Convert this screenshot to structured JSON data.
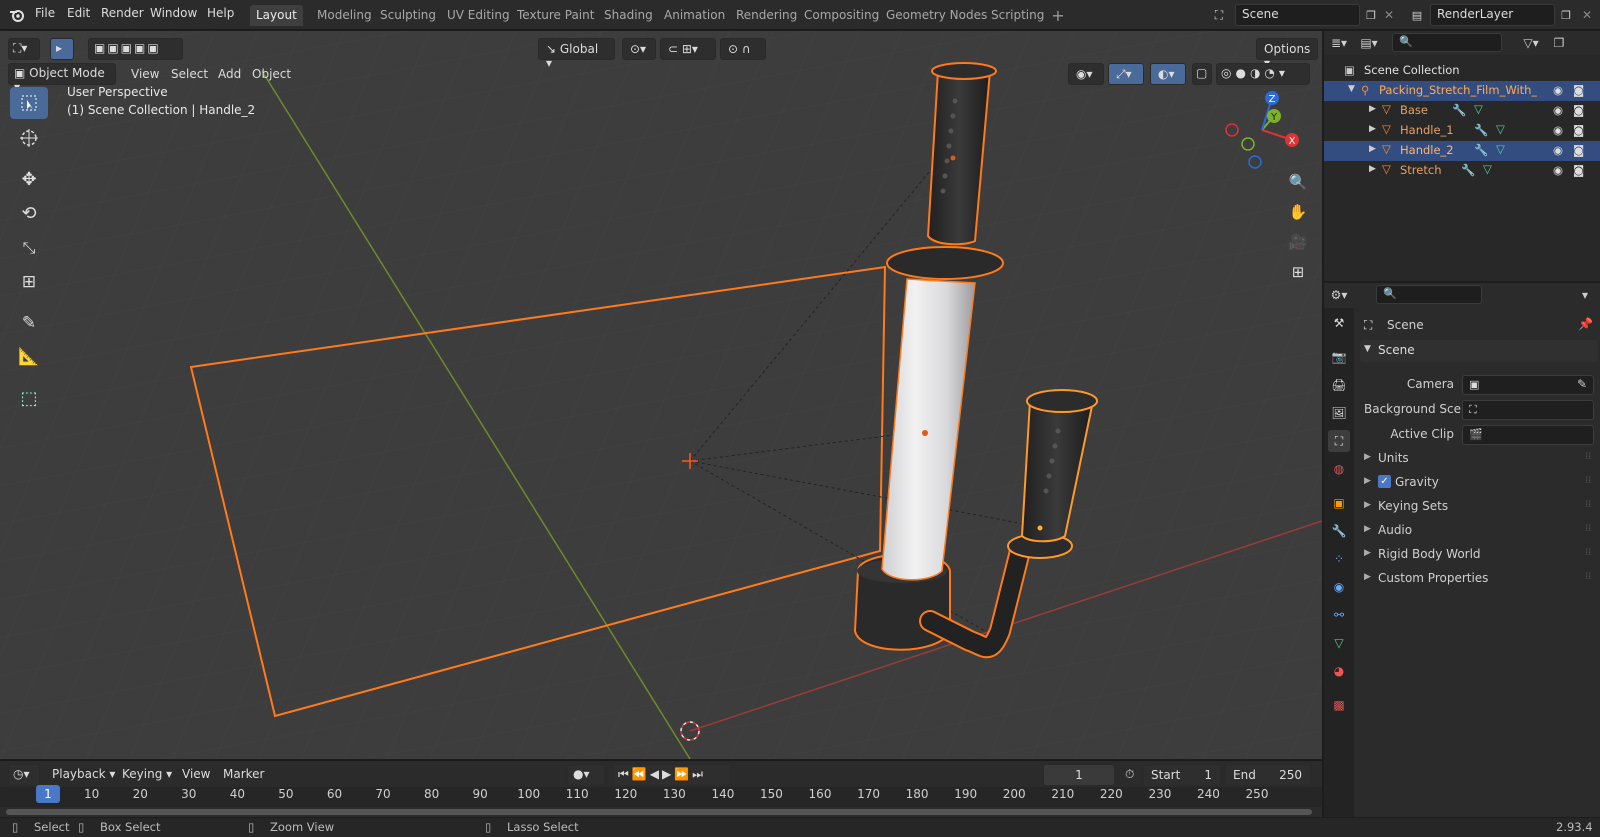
{
  "menu": {
    "items": [
      "File",
      "Edit",
      "Render",
      "Window",
      "Help"
    ]
  },
  "workspaces": [
    "Layout",
    "Modeling",
    "Sculpting",
    "UV Editing",
    "Texture Paint",
    "Shading",
    "Animation",
    "Rendering",
    "Compositing",
    "Geometry Nodes",
    "Scripting"
  ],
  "scene_field": "Scene",
  "renderlayer_field": "RenderLayer",
  "viewport": {
    "mode": "Object Mode",
    "menus": [
      "View",
      "Select",
      "Add",
      "Object"
    ],
    "transform_orientation": "Global",
    "options_label": "Options",
    "info_line1": "User Perspective",
    "info_line2": "(1) Scene Collection | Handle_2",
    "gizmo_axes": {
      "x": "X",
      "y": "Y",
      "z": "Z"
    }
  },
  "outliner": {
    "root": "Scene Collection",
    "collection": "Packing_Stretch_Film_With_[",
    "objects": [
      "Base",
      "Handle_1",
      "Handle_2",
      "Stretch"
    ],
    "selected_index": 2
  },
  "properties": {
    "header": "Scene",
    "panel": "Scene",
    "fields": [
      {
        "label": "Camera"
      },
      {
        "label": "Background Sce..."
      },
      {
        "label": "Active Clip"
      }
    ],
    "collapsed": [
      "Units",
      "Gravity",
      "Keying Sets",
      "Audio",
      "Rigid Body World",
      "Custom Properties"
    ],
    "gravity_checked": true
  },
  "timeline": {
    "menus": [
      "Playback",
      "Keying",
      "View",
      "Marker"
    ],
    "current_frame": "1",
    "start_label": "Start",
    "start": "1",
    "end_label": "End",
    "end": "250",
    "ruler": [
      "1",
      "10",
      "20",
      "30",
      "40",
      "50",
      "60",
      "70",
      "80",
      "90",
      "100",
      "110",
      "120",
      "130",
      "140",
      "150",
      "160",
      "170",
      "180",
      "190",
      "200",
      "210",
      "220",
      "230",
      "240",
      "250"
    ]
  },
  "status": {
    "select": "Select",
    "box_select": "Box Select",
    "zoom_view": "Zoom View",
    "lasso_select": "Lasso Select",
    "version": "2.93.4"
  },
  "colors": {
    "selection_orange": "#ff7a1c",
    "active_blue": "#4a6b9a",
    "outliner_select": "#334d80"
  }
}
